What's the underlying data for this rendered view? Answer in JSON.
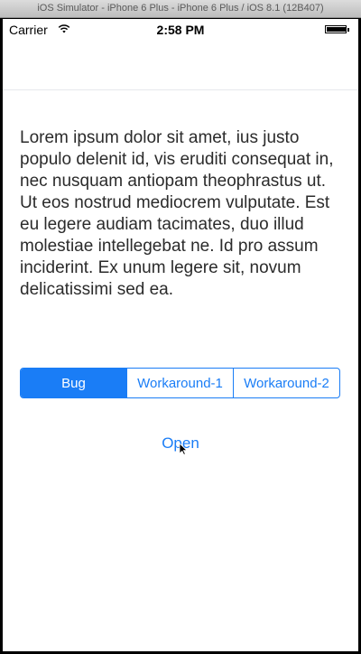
{
  "simulator": {
    "window_title": "iOS Simulator - iPhone 6 Plus - iPhone 6 Plus / iOS 8.1 (12B407)"
  },
  "status_bar": {
    "carrier": "Carrier",
    "time": "2:58 PM",
    "wifi_icon": "wifi-icon",
    "battery_icon": "battery-icon"
  },
  "content": {
    "body_text": "Lorem ipsum dolor sit amet, ius justo populo delenit id, vis eruditi consequat in, nec nusquam antiopam theophrastus ut. Ut eos nostrud mediocrem vulputate. Est eu legere audiam tacimates, duo illud molestiae intellegebat ne. Id pro assum inciderint. Ex unum legere sit, novum delicatissimi sed ea.",
    "segments": [
      {
        "label": "Bug",
        "selected": true
      },
      {
        "label": "Workaround-1",
        "selected": false
      },
      {
        "label": "Workaround-2",
        "selected": false
      }
    ],
    "open_button": "Open"
  },
  "colors": {
    "tint": "#1a7df6",
    "text": "#2b2b2b",
    "background": "#ffffff"
  }
}
